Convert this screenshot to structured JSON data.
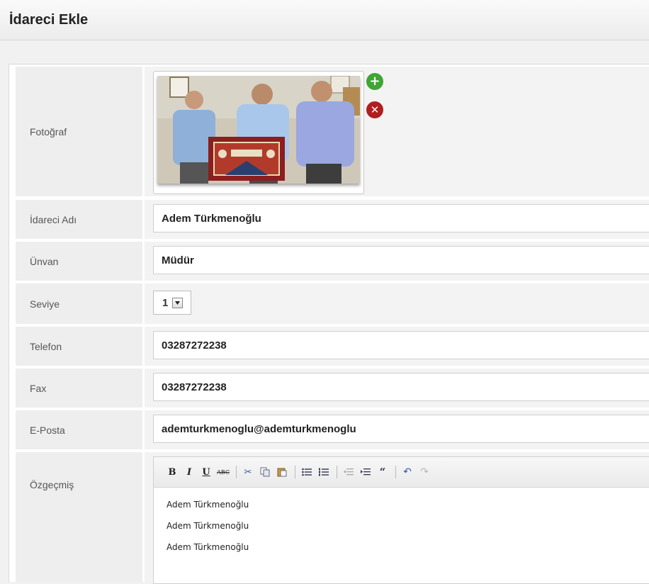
{
  "header": {
    "title": "İdareci Ekle"
  },
  "form": {
    "photo": {
      "label": "Fotoğraf"
    },
    "name": {
      "label": "İdareci Adı",
      "value": "Adem Türkmenoğlu"
    },
    "title": {
      "label": "Ünvan",
      "value": "Müdür"
    },
    "level": {
      "label": "Seviye",
      "value": "1"
    },
    "phone": {
      "label": "Telefon",
      "value": "03287272238"
    },
    "fax": {
      "label": "Fax",
      "value": "03287272238"
    },
    "email": {
      "label": "E-Posta",
      "value": "ademturkmenoglu@ademturkmenoglu"
    },
    "bio": {
      "label": "Özgeçmiş",
      "lines": [
        "Adem Türkmenoğlu",
        "Adem Türkmenoğlu",
        "Adem Türkmenoğlu"
      ]
    }
  },
  "icons": {
    "add": "plus-circle-icon",
    "remove": "x-circle-icon"
  },
  "colors": {
    "add_green": "#3fa535",
    "remove_red": "#b01e1e"
  }
}
